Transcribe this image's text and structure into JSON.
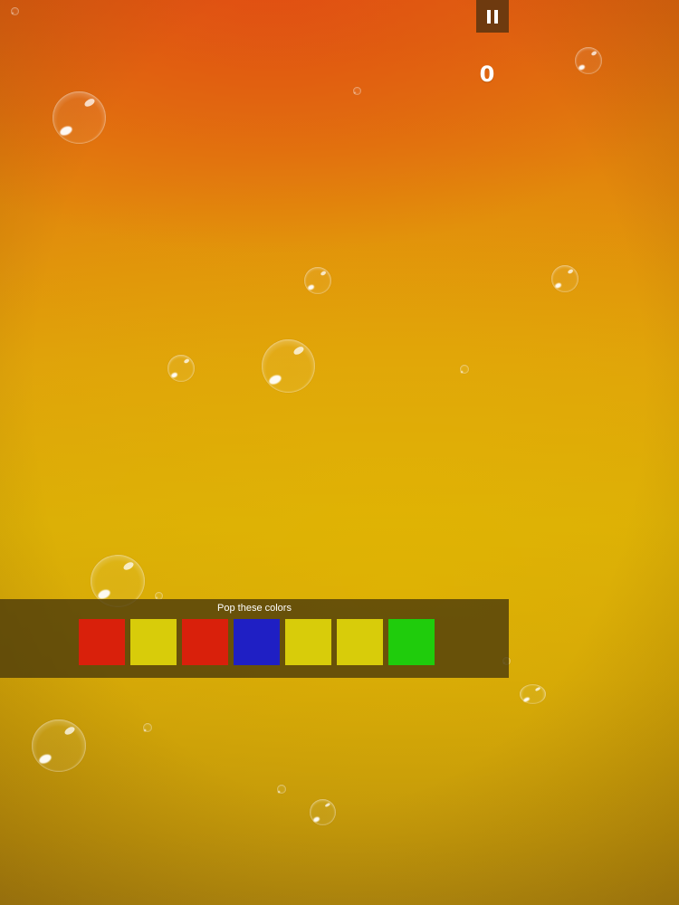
{
  "hud": {
    "pause_icon": "pause-icon",
    "score": "0"
  },
  "target": {
    "title": "Pop these colors",
    "swatches": [
      {
        "color": "#d9200b",
        "name": "red"
      },
      {
        "color": "#d8cc0a",
        "name": "yellow"
      },
      {
        "color": "#d9200b",
        "name": "red"
      },
      {
        "color": "#1f1fc4",
        "name": "blue"
      },
      {
        "color": "#d8cc0a",
        "name": "yellow"
      },
      {
        "color": "#d8cc0a",
        "name": "yellow"
      },
      {
        "color": "#1fcc0c",
        "name": "green"
      }
    ]
  },
  "colors": {
    "background_top": "#e06a0e",
    "background_middle": "#dfa00b",
    "background_bottom": "#a98210",
    "panel": "#48370a",
    "pause_button": "#6e3a0f"
  }
}
